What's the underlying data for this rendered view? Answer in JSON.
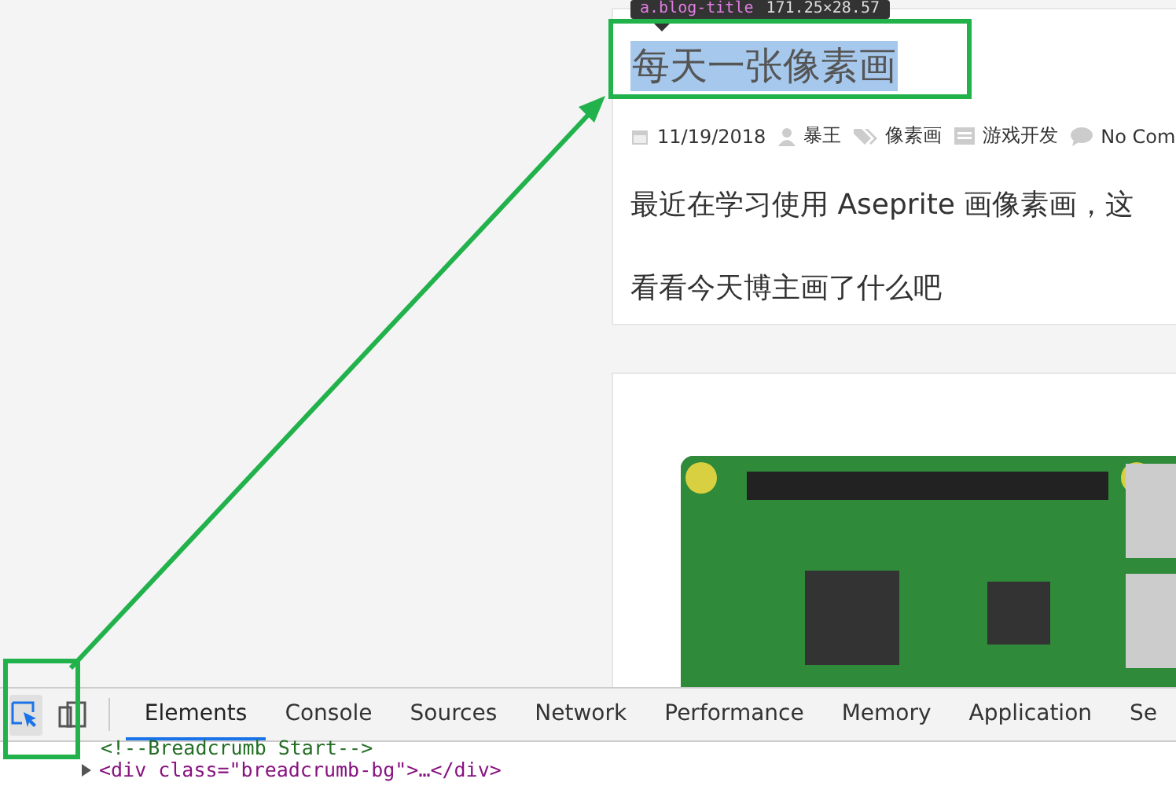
{
  "tooltip": {
    "selector": "a.blog-title",
    "size": "171.25×28.57"
  },
  "post": {
    "title": "每天一张像素画",
    "title_selected": true,
    "meta": [
      {
        "kind": "date",
        "text": "11/19/2018"
      },
      {
        "kind": "author",
        "text": "暴王"
      },
      {
        "kind": "tag",
        "text": "像素画"
      },
      {
        "kind": "category",
        "text": "游戏开发"
      },
      {
        "kind": "comments",
        "text": "No Com"
      }
    ],
    "excerpt": [
      "最近在学习使用 Aseprite 画像素画，这",
      "看看今天博主画了什么吧"
    ]
  },
  "devtools": {
    "tools": [
      {
        "kind": "inspect",
        "selected": true
      },
      {
        "kind": "device",
        "selected": false
      }
    ],
    "tabs": [
      {
        "label": "Elements",
        "selected": true
      },
      {
        "label": "Console",
        "selected": false
      },
      {
        "label": "Sources",
        "selected": false
      },
      {
        "label": "Network",
        "selected": false
      },
      {
        "label": "Performance",
        "selected": false
      },
      {
        "label": "Memory",
        "selected": false
      },
      {
        "label": "Application",
        "selected": false
      },
      {
        "label": "Se",
        "selected": false
      }
    ],
    "code": [
      {
        "kind": "comment",
        "text": "<!--Breadcrumb Start-->"
      },
      {
        "kind": "element",
        "text": "<div class=\"breadcrumb-bg\">…</div>",
        "collapsed": true
      }
    ]
  }
}
